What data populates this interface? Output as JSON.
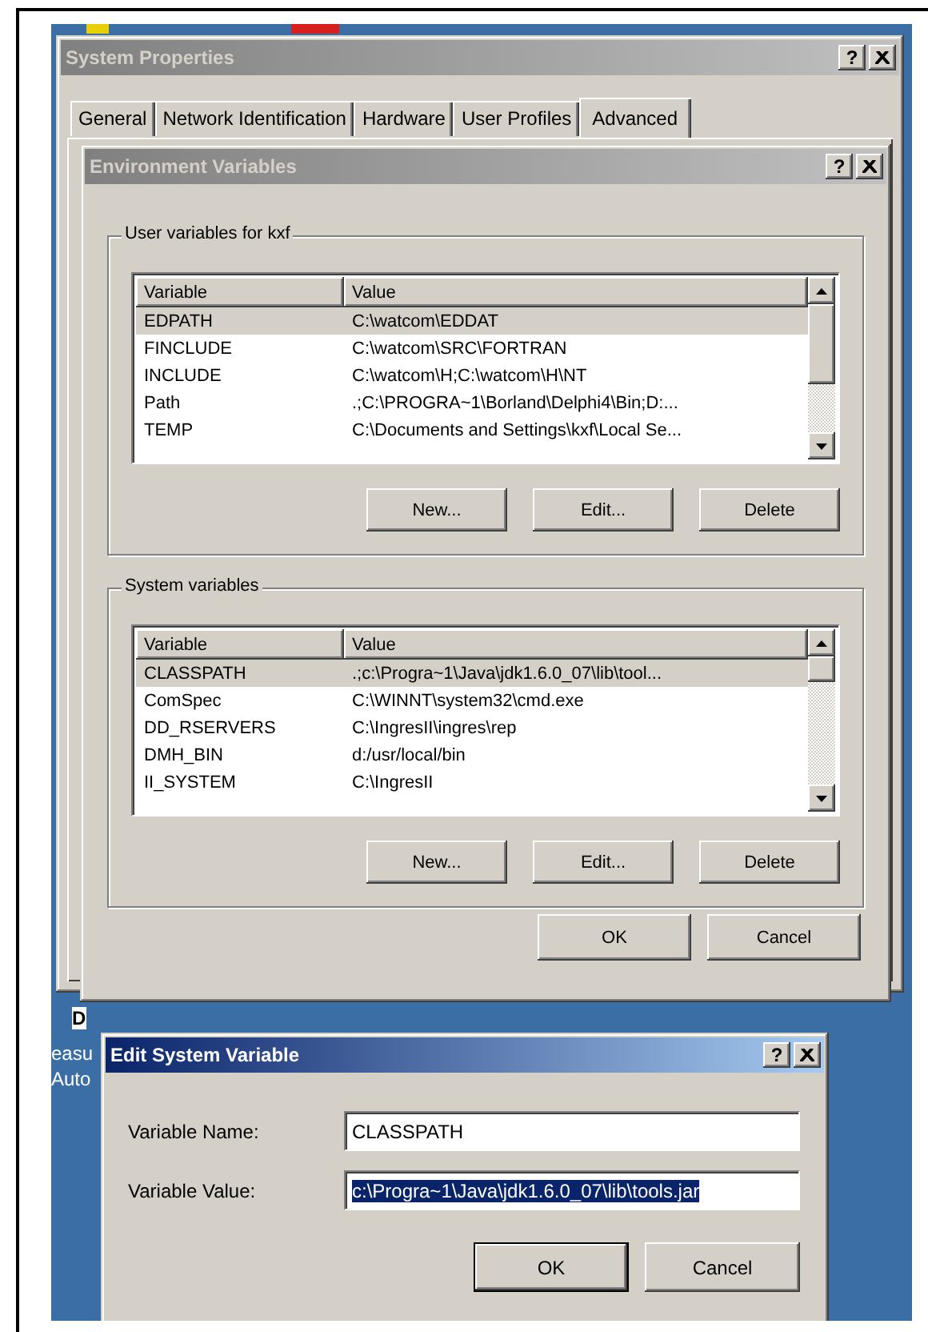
{
  "desktop": {
    "fragments": [
      {
        "text": "D",
        "kind": "bold"
      },
      {
        "text": "easu",
        "kind": "plain"
      },
      {
        "text": "Auto",
        "kind": "plain"
      }
    ]
  },
  "system_properties": {
    "title": "System Properties",
    "active": false,
    "help": "?",
    "tabs": [
      {
        "label": "General",
        "selected": false
      },
      {
        "label": "Network Identification",
        "selected": false
      },
      {
        "label": "Hardware",
        "selected": false
      },
      {
        "label": "User Profiles",
        "selected": false
      },
      {
        "label": "Advanced",
        "selected": true
      }
    ]
  },
  "environment_variables": {
    "title": "Environment Variables",
    "active": false,
    "help": "?",
    "groups": [
      {
        "label": "User variables for kxf",
        "columns": [
          "Variable",
          "Value"
        ],
        "buttons": [
          "New...",
          "Edit...",
          "Delete"
        ],
        "rows": [
          {
            "variable": "EDPATH",
            "value": "C:\\watcom\\EDDAT",
            "selected": true
          },
          {
            "variable": "FINCLUDE",
            "value": "C:\\watcom\\SRC\\FORTRAN",
            "selected": false
          },
          {
            "variable": "INCLUDE",
            "value": "C:\\watcom\\H;C:\\watcom\\H\\NT",
            "selected": false
          },
          {
            "variable": "Path",
            "value": ".;C:\\PROGRA~1\\Borland\\Delphi4\\Bin;D:...",
            "selected": false
          },
          {
            "variable": "TEMP",
            "value": "C:\\Documents and Settings\\kxf\\Local Se...",
            "selected": false
          }
        ]
      },
      {
        "label": "System variables",
        "columns": [
          "Variable",
          "Value"
        ],
        "buttons": [
          "New...",
          "Edit...",
          "Delete"
        ],
        "rows": [
          {
            "variable": "CLASSPATH",
            "value": ".;c:\\Progra~1\\Java\\jdk1.6.0_07\\lib\\tool...",
            "selected": true
          },
          {
            "variable": "ComSpec",
            "value": "C:\\WINNT\\system32\\cmd.exe",
            "selected": false
          },
          {
            "variable": "DD_RSERVERS",
            "value": "C:\\IngresII\\ingres\\rep",
            "selected": false
          },
          {
            "variable": "DMH_BIN",
            "value": "d:/usr/local/bin",
            "selected": false
          },
          {
            "variable": "II_SYSTEM",
            "value": "C:\\IngresII",
            "selected": false
          }
        ]
      }
    ],
    "buttons": [
      "OK",
      "Cancel"
    ]
  },
  "edit_system_variable": {
    "title": "Edit System Variable",
    "active": true,
    "help": "?",
    "fields": [
      {
        "label": "Variable Name:",
        "value": "CLASSPATH",
        "text_selected": false
      },
      {
        "label": "Variable Value:",
        "value": "c:\\Progra~1\\Java\\jdk1.6.0_07\\lib\\tools.jar",
        "text_selected": true
      }
    ],
    "buttons": [
      {
        "label": "OK",
        "default": true
      },
      {
        "label": "Cancel",
        "default": false
      }
    ]
  }
}
